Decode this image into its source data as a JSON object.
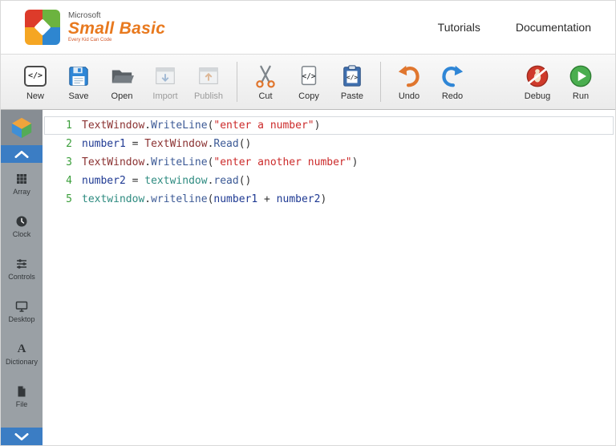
{
  "header": {
    "microsoft": "Microsoft",
    "product": "Small Basic",
    "tagline": "Every Kid Can Code",
    "nav": [
      {
        "label": "Tutorials"
      },
      {
        "label": "Documentation"
      }
    ]
  },
  "toolbar": {
    "new": "New",
    "save": "Save",
    "open": "Open",
    "import": "Import",
    "publish": "Publish",
    "cut": "Cut",
    "copy": "Copy",
    "paste": "Paste",
    "undo": "Undo",
    "redo": "Redo",
    "debug": "Debug",
    "run": "Run"
  },
  "sidebar": {
    "items": [
      {
        "label": "Array",
        "icon": "grid-icon"
      },
      {
        "label": "Clock",
        "icon": "clock-icon"
      },
      {
        "label": "Controls",
        "icon": "sliders-icon"
      },
      {
        "label": "Desktop",
        "icon": "monitor-icon"
      },
      {
        "label": "Dictionary",
        "icon": "letter-a-icon"
      },
      {
        "label": "File",
        "icon": "file-icon"
      }
    ]
  },
  "editor": {
    "line_number_color": "#3a9e3a",
    "token_colors": {
      "object": "#8b3232",
      "member": "#3c5a96",
      "string": "#cc2b2b",
      "variable": "#1f3a93",
      "identifier": "#2e8b80",
      "punct": "#333333"
    },
    "lines": [
      {
        "number": "1",
        "current": true,
        "tokens": [
          {
            "t": "object",
            "v": "TextWindow"
          },
          {
            "t": "punct",
            "v": "."
          },
          {
            "t": "member",
            "v": "WriteLine"
          },
          {
            "t": "punct",
            "v": "("
          },
          {
            "t": "string",
            "v": "\"enter a number\""
          },
          {
            "t": "punct",
            "v": ")"
          }
        ]
      },
      {
        "number": "2",
        "current": false,
        "tokens": [
          {
            "t": "variable",
            "v": "number1"
          },
          {
            "t": "punct",
            "v": " = "
          },
          {
            "t": "object",
            "v": "TextWindow"
          },
          {
            "t": "punct",
            "v": "."
          },
          {
            "t": "member",
            "v": "Read"
          },
          {
            "t": "punct",
            "v": "()"
          }
        ]
      },
      {
        "number": "3",
        "current": false,
        "tokens": [
          {
            "t": "object",
            "v": "TextWindow"
          },
          {
            "t": "punct",
            "v": "."
          },
          {
            "t": "member",
            "v": "WriteLine"
          },
          {
            "t": "punct",
            "v": "("
          },
          {
            "t": "string",
            "v": "\"enter another number\""
          },
          {
            "t": "punct",
            "v": ")"
          }
        ]
      },
      {
        "number": "4",
        "current": false,
        "tokens": [
          {
            "t": "variable",
            "v": "number2"
          },
          {
            "t": "punct",
            "v": " = "
          },
          {
            "t": "identifier",
            "v": "textwindow"
          },
          {
            "t": "punct",
            "v": "."
          },
          {
            "t": "member",
            "v": "read"
          },
          {
            "t": "punct",
            "v": "()"
          }
        ]
      },
      {
        "number": "5",
        "current": false,
        "tokens": [
          {
            "t": "identifier",
            "v": "textwindow"
          },
          {
            "t": "punct",
            "v": "."
          },
          {
            "t": "member",
            "v": "writeline"
          },
          {
            "t": "punct",
            "v": "("
          },
          {
            "t": "variable",
            "v": "number1"
          },
          {
            "t": "punct",
            "v": " + "
          },
          {
            "t": "variable",
            "v": "number2"
          },
          {
            "t": "punct",
            "v": ")"
          }
        ]
      }
    ]
  },
  "colors": {
    "accent_blue": "#3b7dc4",
    "brand_orange": "#e8791e",
    "sidebar_gray": "#9aa0a5",
    "run_green": "#4aae4f",
    "debug_red": "#cf3a2b"
  }
}
